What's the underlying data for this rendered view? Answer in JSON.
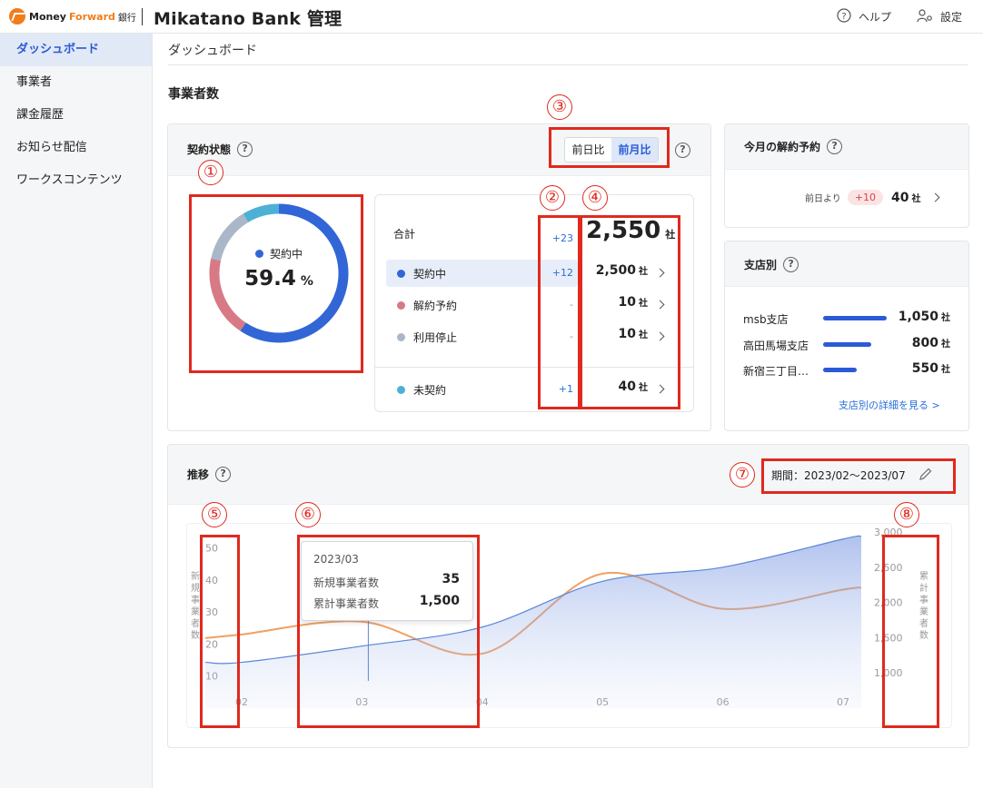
{
  "header": {
    "brand_money": "Money",
    "brand_forward": "Forward",
    "brand_bank": "銀行",
    "app_title": "Mikatano Bank 管理",
    "help_label": "ヘルプ",
    "settings_label": "設定"
  },
  "sidebar": {
    "items": [
      {
        "label": "ダッシュボード",
        "active": true
      },
      {
        "label": "事業者"
      },
      {
        "label": "課金履歴"
      },
      {
        "label": "お知らせ配信"
      },
      {
        "label": "ワークスコンテンツ"
      }
    ]
  },
  "main": {
    "breadcrumb": "ダッシュボード",
    "section_title": "事業者数"
  },
  "contract_status": {
    "title": "契約状態",
    "help": "?",
    "toggle": {
      "options": [
        "前日比",
        "前月比"
      ],
      "selected": "前月比"
    },
    "donut": {
      "label": "契約中",
      "value": "59.4",
      "unit": "%",
      "segments": [
        {
          "name": "契約中",
          "fraction": 0.594,
          "color": "#3266d6"
        },
        {
          "name": "解約予約",
          "fraction": 0.19,
          "color": "#d77a86"
        },
        {
          "name": "利用停止",
          "fraction": 0.13,
          "color": "#a9b7c9"
        },
        {
          "name": "未契約",
          "fraction": 0.086,
          "color": "#4fb0d6"
        }
      ]
    },
    "total": {
      "label": "合計",
      "delta": "+23",
      "value": "2,550",
      "unit": "社"
    },
    "rows": [
      {
        "label": "契約中",
        "color": "#3266d6",
        "delta": "+12",
        "value": "2,500",
        "unit": "社"
      },
      {
        "label": "解約予約",
        "color": "#d77a86",
        "delta": "-",
        "value": "10",
        "unit": "社"
      },
      {
        "label": "利用停止",
        "color": "#a9b7c9",
        "delta": "-",
        "value": "10",
        "unit": "社"
      },
      {
        "label": "未契約",
        "color": "#4fb0d6",
        "delta": "+1",
        "value": "40",
        "unit": "社"
      }
    ]
  },
  "cancellation": {
    "title": "今月の解約予約",
    "help": "?",
    "prefix": "前日より",
    "badge": "+10",
    "value": "40",
    "unit": "社"
  },
  "branches": {
    "title": "支店別",
    "help": "?",
    "rows": [
      {
        "name": "msb支店",
        "value": "1,050",
        "unit": "社",
        "num": 1050
      },
      {
        "name": "高田馬場支店",
        "value": "800",
        "unit": "社",
        "num": 800
      },
      {
        "name": "新宿三丁目…",
        "value": "550",
        "unit": "社",
        "num": 550
      }
    ],
    "detail_link": "支店別の詳細を見る >"
  },
  "trend": {
    "title": "推移",
    "help": "?",
    "period_label": "期間：2023/02〜2023/07",
    "left_axis_title": "新規事業者数",
    "right_axis_title": "累計事業者数",
    "tooltip": {
      "month": "2023/03",
      "new_label": "新規事業者数",
      "new_value": "35",
      "total_label": "累計事業者数",
      "total_value": "1,500"
    }
  },
  "annotations": [
    "①",
    "②",
    "③",
    "④",
    "⑤",
    "⑥",
    "⑦",
    "⑧"
  ],
  "chart_data": {
    "type": "line",
    "categories": [
      "02",
      "03",
      "04",
      "05",
      "06",
      "07"
    ],
    "left_ticks": [
      "50",
      "40",
      "30",
      "20",
      "10"
    ],
    "right_ticks": [
      "3,000",
      "2,500",
      "2,000",
      "1,500",
      "1,000"
    ],
    "ylim_left": [
      0,
      55
    ],
    "ylim_right": [
      500,
      3000
    ],
    "series": [
      {
        "name": "新規事業者数",
        "axis": "left",
        "color": "#f0a062",
        "values": [
          23,
          27,
          17,
          42,
          31,
          37
        ]
      },
      {
        "name": "累計事業者数",
        "axis": "right",
        "color": "#5b86d9",
        "fill": true,
        "values": [
          1150,
          1380,
          1650,
          2300,
          2500,
          2900
        ]
      }
    ],
    "highlight_category": "03"
  }
}
